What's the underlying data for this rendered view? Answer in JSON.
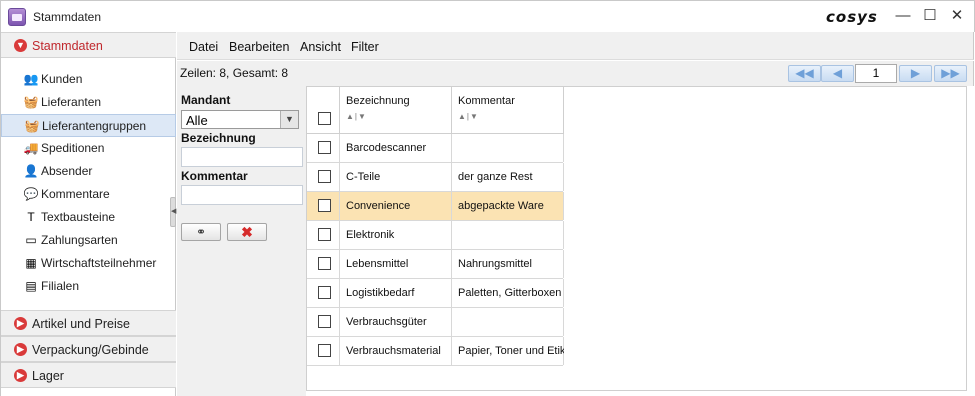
{
  "window": {
    "title": "Stammdaten",
    "brand": "cosys"
  },
  "sidebar": {
    "active_section": "Stammdaten",
    "items": [
      {
        "label": "Kunden",
        "icon": "users-icon",
        "glyph": "👥"
      },
      {
        "label": "Lieferanten",
        "icon": "supplier-icon",
        "glyph": "🧺"
      },
      {
        "label": "Lieferantengruppen",
        "icon": "supplier-group-icon",
        "glyph": "🧺"
      },
      {
        "label": "Speditionen",
        "icon": "truck-icon",
        "glyph": "🚚"
      },
      {
        "label": "Absender",
        "icon": "sender-icon",
        "glyph": "👤"
      },
      {
        "label": "Kommentare",
        "icon": "comment-icon",
        "glyph": "💬"
      },
      {
        "label": "Textbausteine",
        "icon": "text-block-icon",
        "glyph": "T"
      },
      {
        "label": "Zahlungsarten",
        "icon": "credit-card-icon",
        "glyph": "▭"
      },
      {
        "label": "Wirtschaftsteilnehmer",
        "icon": "business-icon",
        "glyph": "▦"
      },
      {
        "label": "Filialen",
        "icon": "branch-icon",
        "glyph": "▤"
      }
    ],
    "selected_index": 2,
    "sections": [
      {
        "label": "Artikel und Preise"
      },
      {
        "label": "Verpackung/Gebinde"
      },
      {
        "label": "Lager"
      }
    ]
  },
  "menu": {
    "items": [
      "Datei",
      "Bearbeiten",
      "Ansicht",
      "Filter"
    ]
  },
  "info": {
    "row_count": "Zeilen: 8, Gesamt: 8",
    "page": "1"
  },
  "filter": {
    "mandant_label": "Mandant",
    "mandant_value": "Alle",
    "bezeichnung_label": "Bezeichnung",
    "bezeichnung_value": "",
    "kommentar_label": "Kommentar",
    "kommentar_value": ""
  },
  "table": {
    "columns": [
      "Bezeichnung",
      "Kommentar"
    ],
    "rows": [
      {
        "bezeichnung": "Barcodescanner",
        "kommentar": ""
      },
      {
        "bezeichnung": "C-Teile",
        "kommentar": "der ganze Rest"
      },
      {
        "bezeichnung": "Convenience",
        "kommentar": "abgepackte Ware"
      },
      {
        "bezeichnung": "Elektronik",
        "kommentar": ""
      },
      {
        "bezeichnung": "Lebensmittel",
        "kommentar": "Nahrungsmittel"
      },
      {
        "bezeichnung": "Logistikbedarf",
        "kommentar": "Paletten, Gitterboxen"
      },
      {
        "bezeichnung": "Verbrauchsgüter",
        "kommentar": ""
      },
      {
        "bezeichnung": "Verbrauchsmaterial",
        "kommentar": "Papier, Toner und Etike"
      }
    ],
    "selected_row": 2
  },
  "colors": {
    "accent_red": "#c0282d",
    "selection_row": "#fbe3b3",
    "selection_nav": "#dde8f6"
  }
}
